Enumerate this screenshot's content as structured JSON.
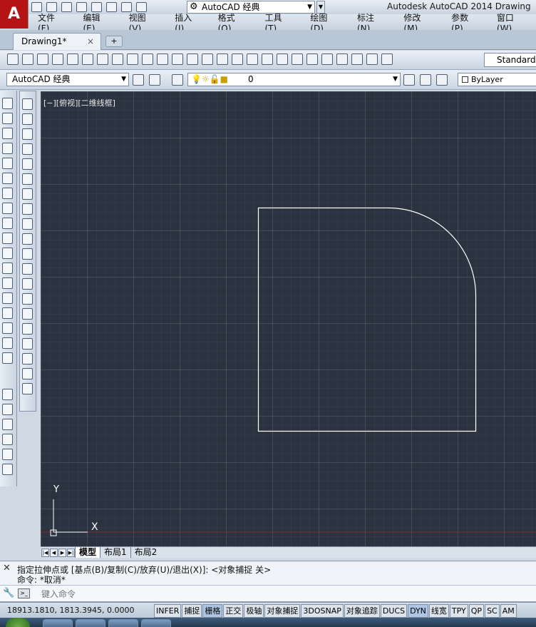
{
  "app": {
    "logo_letter": "A",
    "title": "Autodesk AutoCAD 2014",
    "title_tail": "Drawing",
    "workspace_dropdown": "AutoCAD 经典"
  },
  "menu": [
    "文件(F)",
    "编辑(E)",
    "视图(V)",
    "插入(I)",
    "格式(O)",
    "工具(T)",
    "绘图(D)",
    "标注(N)",
    "修改(M)",
    "参数(P)",
    "窗口(W)"
  ],
  "tabs": {
    "doc_tab": "Drawing1*",
    "close": "×",
    "new": "+"
  },
  "toolbar2": {
    "workspace": "AutoCAD 经典",
    "layer_name": "0",
    "color": "ByLayer"
  },
  "toolbar1": {
    "text_style": "Standard"
  },
  "viewport": {
    "label": "[−][俯视][二维线框]",
    "ucs_x": "X",
    "ucs_y": "Y"
  },
  "model_tabs": [
    "模型",
    "布局1",
    "布局2"
  ],
  "command": {
    "history_line1": "指定拉伸点或 [基点(B)/复制(C)/放弃(U)/退出(X)]: <对象捕捉 关>",
    "history_line2": "命令: *取消*",
    "placeholder": "键入命令",
    "prompt_icon": "command-prompt-icon"
  },
  "status": {
    "coords": "18913.1810, 1813.3945, 0.0000",
    "toggles": [
      "INFER",
      "捕捉",
      "栅格",
      "正交",
      "极轴",
      "对象捕捉",
      "3DOSNAP",
      "对象追踪",
      "DUCS",
      "DYN",
      "线宽",
      "TPY",
      "QP",
      "SC",
      "AM"
    ],
    "active_toggles": [
      "栅格",
      "DYN"
    ]
  },
  "colors": {
    "canvas_bg": "#2b3340",
    "geometry": "#ffffff",
    "logo_red": "#b51414"
  }
}
